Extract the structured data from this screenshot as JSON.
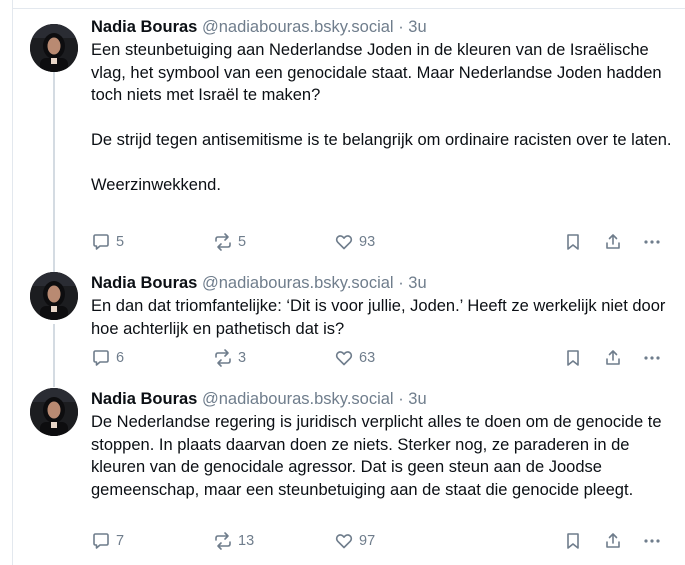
{
  "posts": [
    {
      "author": "Nadia Bouras",
      "handle": "@nadiabouras.bsky.social",
      "separator": "·",
      "time": "3u",
      "paragraphs": [
        "Een steunbetuiging aan Nederlandse Joden in de kleuren van de Israëlische vlag, het symbool van een genocidale staat. Maar Nederlandse Joden hadden toch niets met Israël te maken?",
        "De strijd tegen antisemitisme is te belangrijk om ordinaire racisten over te laten.",
        "Weerzinwekkend."
      ],
      "replies": "5",
      "reposts": "5",
      "likes": "93"
    },
    {
      "author": "Nadia Bouras",
      "handle": "@nadiabouras.bsky.social",
      "separator": "·",
      "time": "3u",
      "paragraphs": [
        "En dan dat triomfantelijke: ‘Dit is voor jullie, Joden.’ Heeft ze werkelijk niet door hoe achterlijk en pathetisch dat is?"
      ],
      "replies": "6",
      "reposts": "3",
      "likes": "63"
    },
    {
      "author": "Nadia Bouras",
      "handle": "@nadiabouras.bsky.social",
      "separator": "·",
      "time": "3u",
      "paragraphs": [
        "De Nederlandse regering is juridisch verplicht alles te doen om de genocide te stoppen. In plaats daarvan doen ze niets. Sterker nog, ze paraderen in de kleuren van de genocidale agressor. Dat is geen steun aan de Joodse gemeenschap, maar een steunbetuiging aan de staat die genocide pleegt."
      ],
      "replies": "7",
      "reposts": "13",
      "likes": "97"
    }
  ],
  "icons": {
    "reply": "speech-bubble-icon",
    "repost": "repost-arrows-icon",
    "like": "heart-outline-icon",
    "bookmark": "bookmark-icon",
    "share": "share-upload-icon",
    "more": "ellipsis-icon"
  },
  "colors": {
    "text": "#0b0f14",
    "muted": "#6f7d8c",
    "divider": "#e3e8ee",
    "thread_line": "#d4dbe2"
  }
}
